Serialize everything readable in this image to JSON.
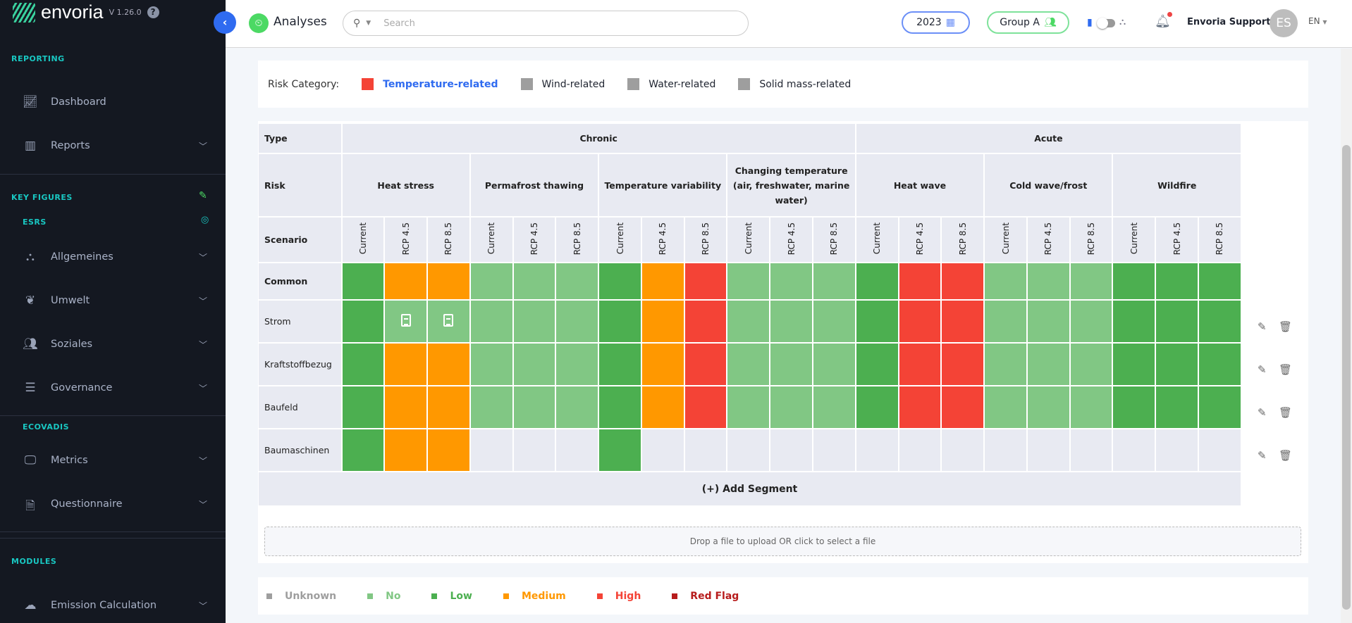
{
  "app": {
    "name": "envoria",
    "version": "V 1.26.0"
  },
  "sidebar": {
    "sections": [
      {
        "label": "REPORTING"
      },
      {
        "label": "KEY FIGURES"
      },
      {
        "label": "ESRS"
      },
      {
        "label": "ECOVADIS"
      },
      {
        "label": "MODULES"
      }
    ],
    "items": [
      {
        "label": "Dashboard",
        "icon": "chart-line-icon"
      },
      {
        "label": "Reports",
        "icon": "report-icon"
      },
      {
        "label": "Allgemeines",
        "icon": "sitemap-icon"
      },
      {
        "label": "Umwelt",
        "icon": "seedling-icon"
      },
      {
        "label": "Soziales",
        "icon": "users-icon"
      },
      {
        "label": "Governance",
        "icon": "governance-icon"
      },
      {
        "label": "Metrics",
        "icon": "monitor-chart-icon"
      },
      {
        "label": "Questionnaire",
        "icon": "file-question-icon"
      },
      {
        "label": "Emission Calculation",
        "icon": "co2-cloud-icon"
      }
    ]
  },
  "header": {
    "title": "Analyses",
    "search_placeholder": "Search",
    "year": "2023",
    "group": "Group A",
    "user": "Envoria Support",
    "avatar": "ES",
    "language": "EN"
  },
  "risk_category": {
    "label": "Risk Category:",
    "options": [
      {
        "label": "Temperature-related",
        "color": "#f44336",
        "active": true
      },
      {
        "label": "Wind-related",
        "color": "#9e9e9e"
      },
      {
        "label": "Water-related",
        "color": "#9e9e9e"
      },
      {
        "label": "Solid mass-related",
        "color": "#9e9e9e"
      }
    ]
  },
  "table": {
    "type_label": "Type",
    "risk_label": "Risk",
    "scenario_label": "Scenario",
    "types": [
      {
        "label": "Chronic",
        "span": 4
      },
      {
        "label": "Acute",
        "span": 3
      }
    ],
    "risks": [
      "Heat stress",
      "Permafrost thawing",
      "Temperature variability",
      "Changing temperature (air, freshwater, marine water)",
      "Heat wave",
      "Cold wave/frost",
      "Wildfire"
    ],
    "scenarios": [
      "Current",
      "RCP 4.5",
      "RCP 8.5"
    ],
    "rows": [
      {
        "segment": "Common",
        "bold": true,
        "cells": "LMMNNNLMHNNNLHHNNNLLL"
      },
      {
        "segment": "Strom",
        "cells": "LNNNNNLMHNNNLHHNNNLLL",
        "notes": [
          1,
          2
        ]
      },
      {
        "segment": "Kraftstoffbezug",
        "cells": "LMMNNNLMHNNNLHHNNNLLL"
      },
      {
        "segment": "Baufeld",
        "cells": "LMMNNNLMHNNNLHHNNNLLL"
      },
      {
        "segment": "Baumaschinen",
        "cells": "LMMEEELEEEEEEEEEEEEEE"
      }
    ],
    "add_segment": "(+) Add Segment"
  },
  "dropzone": "Drop a file to upload OR click to select a file",
  "legend": [
    {
      "label": "Unknown",
      "color": "#9e9e9e"
    },
    {
      "label": "No",
      "color": "#81c784"
    },
    {
      "label": "Low",
      "color": "#4caf50"
    },
    {
      "label": "Medium",
      "color": "#ff9800"
    },
    {
      "label": "High",
      "color": "#f44336"
    },
    {
      "label": "Red Flag",
      "color": "#b71c1c"
    }
  ]
}
